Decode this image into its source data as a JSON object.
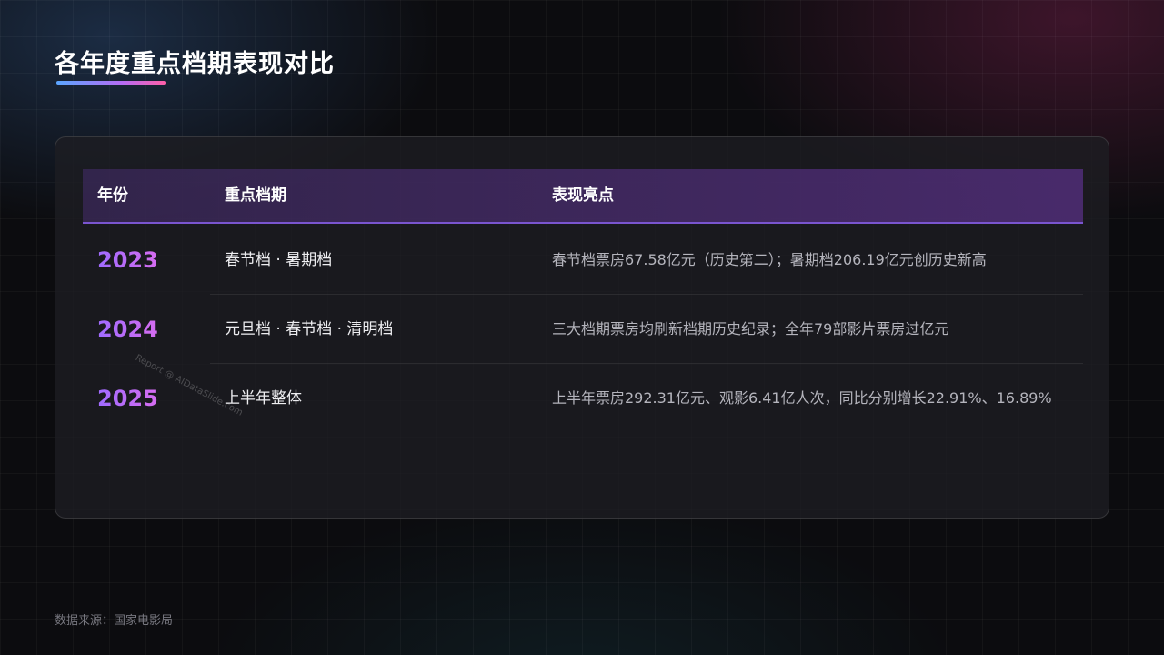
{
  "page": {
    "title": "各年度重点档期表现对比",
    "source": "数据来源：国家电影局",
    "watermark": "Report @ AIDataSlide.com"
  },
  "table": {
    "headers": {
      "year": "年份",
      "period": "重点档期",
      "highlight": "表现亮点"
    },
    "rows": [
      {
        "year": "2023",
        "period": "春节档 · 暑期档",
        "highlight": "春节档票房67.58亿元（历史第二）；暑期档206.19亿元创历史新高"
      },
      {
        "year": "2024",
        "period": "元旦档 · 春节档 · 清明档",
        "highlight": "三大档期票房均刷新档期历史纪录；全年79部影片票房过亿元"
      },
      {
        "year": "2025",
        "period": "上半年整体",
        "highlight": "上半年票房292.31亿元、观影6.41亿人次，同比分别增长22.91%、16.89%"
      }
    ]
  },
  "colors": {
    "accent_purple": "#a06bff",
    "accent_pink": "#d66cf0",
    "header_border": "#7a55d0",
    "underline_start": "#5aa6ff",
    "underline_end": "#ff5fa8"
  }
}
